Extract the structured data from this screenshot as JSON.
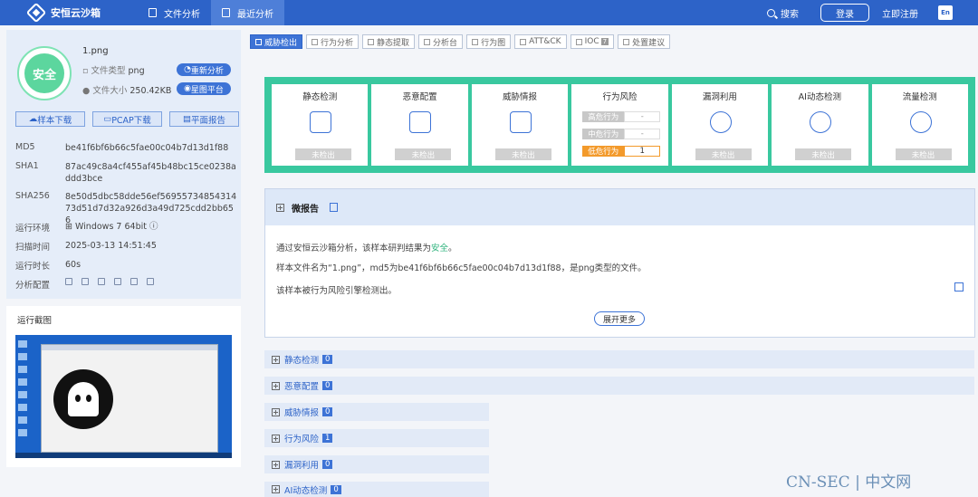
{
  "header": {
    "logo": "安恒云沙箱",
    "nav": [
      "文件分析",
      "最近分析"
    ],
    "search": "搜索",
    "login": "登录",
    "register": "立即注册",
    "lang": "En"
  },
  "file": {
    "badge": "安全",
    "name": "1.png",
    "type_label": "文件类型",
    "type_value": "png",
    "size_label": "文件大小",
    "size_value": "250.42KB",
    "reanalyze": "重新分析",
    "platform": "星图平台"
  },
  "downloads": [
    "样本下载",
    "PCAP下载",
    "平面报告"
  ],
  "details": [
    {
      "k": "MD5",
      "v": "be41f6bf6b66c5fae00c04b7d13d1f88"
    },
    {
      "k": "SHA1",
      "v": "87ac49c8a4cf455af45b48bc15ce0238addd3bce"
    },
    {
      "k": "SHA256",
      "v": "8e50d5dbc58dde56ef5695573485431473d51d7d32a926d3a49d725cdd2bb656"
    },
    {
      "k": "运行环境",
      "v": "Windows 7 64bit"
    },
    {
      "k": "扫描时间",
      "v": "2025-03-13 14:51:45"
    },
    {
      "k": "运行时长",
      "v": "60s"
    },
    {
      "k": "分析配置",
      "v": ""
    }
  ],
  "screenshot_title": "运行截图",
  "tabs": [
    {
      "label": "威胁检出"
    },
    {
      "label": "行为分析"
    },
    {
      "label": "静态提取"
    },
    {
      "label": "分析台"
    },
    {
      "label": "行为图"
    },
    {
      "label": "ATT&CK"
    },
    {
      "label": "IOC",
      "num": "7"
    },
    {
      "label": "处置建议"
    }
  ],
  "cards": [
    {
      "title": "静态检测",
      "status": "未检出"
    },
    {
      "title": "恶意配置",
      "status": "未检出"
    },
    {
      "title": "威胁情报",
      "status": "未检出"
    },
    {
      "title": "行为风险",
      "risks": [
        {
          "l": "高危行为",
          "v": "-"
        },
        {
          "l": "中危行为",
          "v": "-"
        },
        {
          "l": "低危行为",
          "v": "1"
        }
      ]
    },
    {
      "title": "漏洞利用",
      "status": "未检出"
    },
    {
      "title": "AI动态检测",
      "status": "未检出"
    },
    {
      "title": "流量检测",
      "status": "未检出"
    }
  ],
  "micro": {
    "title": "微报告",
    "line1a": "通过安恒云沙箱分析，该样本研判结果为",
    "line1b": "安全",
    "line1c": "。",
    "line2": "样本文件名为“1.png”，md5为be41f6bf6b66c5fae00c04b7d13d1f88，是png类型的文件。",
    "line3": "该样本被行为风险引擎检测出。",
    "more": "展开更多"
  },
  "sections": [
    {
      "t": "静态检测",
      "n": "0"
    },
    {
      "t": "恶意配置",
      "n": "0"
    },
    {
      "t": "威胁情报",
      "n": "0"
    },
    {
      "t": "行为风险",
      "n": "1"
    },
    {
      "t": "漏洞利用",
      "n": "0"
    },
    {
      "t": "AI动态检测",
      "n": "0"
    }
  ],
  "watermark": "CN-SEC | 中文网"
}
